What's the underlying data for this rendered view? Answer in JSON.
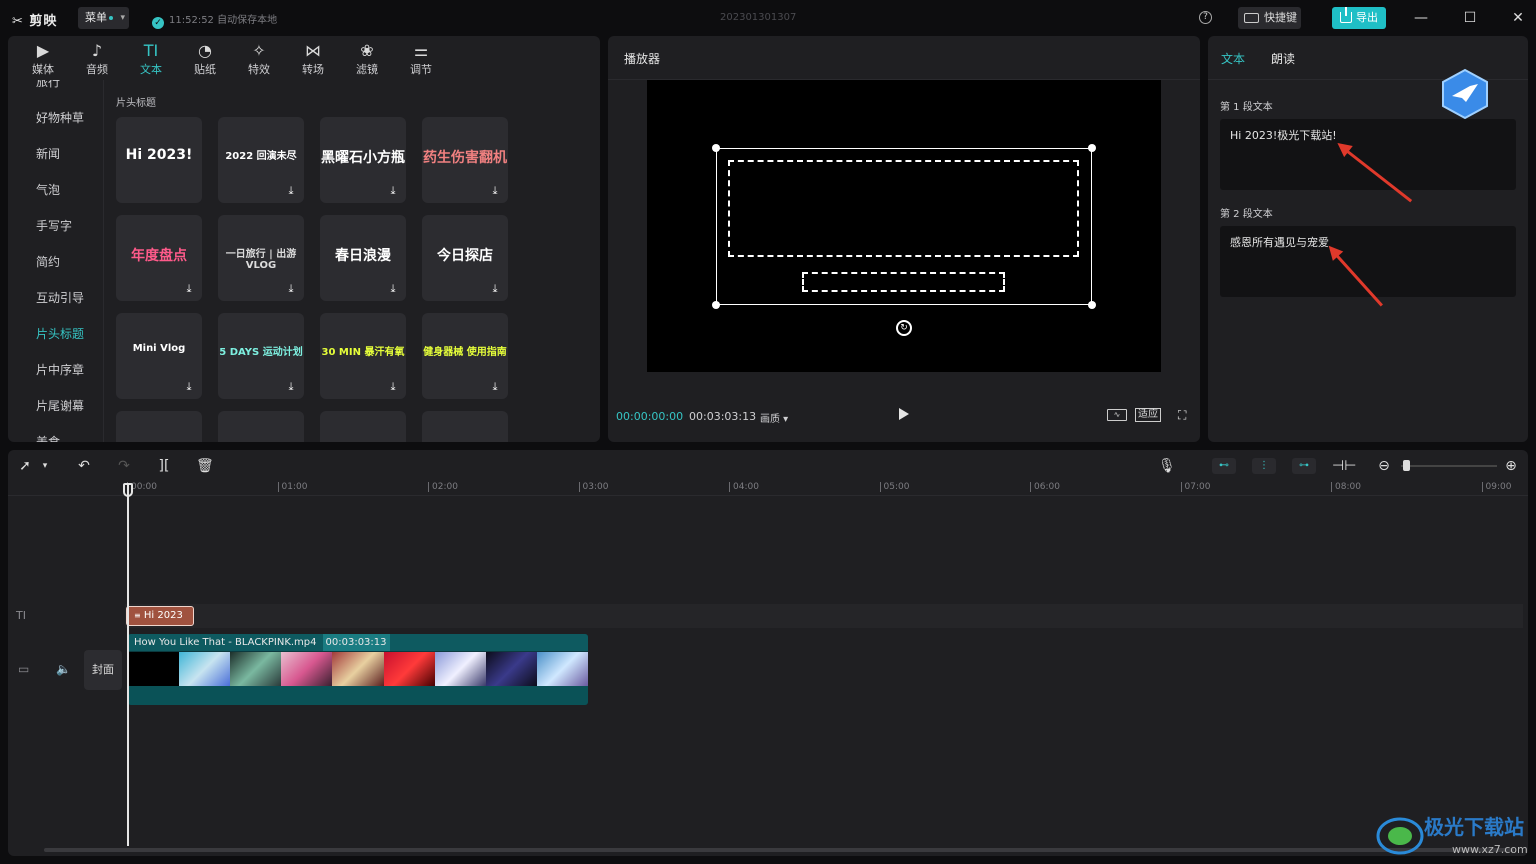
{
  "app": {
    "logo": "剪映",
    "menu_label": "菜单",
    "save_status": "11:52:52 自动保存本地",
    "project_name": "202301301307",
    "help_glyph": "?",
    "shortcut_label": "快捷键",
    "export_label": "导出"
  },
  "media_panel": {
    "tabs": [
      {
        "label": "媒体",
        "icon": "media-icon"
      },
      {
        "label": "音频",
        "icon": "audio-icon"
      },
      {
        "label": "文本",
        "icon": "text-icon",
        "active": true
      },
      {
        "label": "贴纸",
        "icon": "sticker-icon"
      },
      {
        "label": "特效",
        "icon": "effects-icon"
      },
      {
        "label": "转场",
        "icon": "transition-icon"
      },
      {
        "label": "滤镜",
        "icon": "filter-icon"
      },
      {
        "label": "调节",
        "icon": "adjust-icon"
      }
    ],
    "categories": [
      "旅行",
      "好物种草",
      "新闻",
      "气泡",
      "手写字",
      "简约",
      "互动引导",
      "片头标题",
      "片中序章",
      "片尾谢幕",
      "美食"
    ],
    "active_category": "片头标题",
    "section_title": "片头标题",
    "templates": [
      {
        "text": "Hi 2023!",
        "color": "#ffffff",
        "downloaded": true
      },
      {
        "text": "2022 回演未尽",
        "color": "#ffffff",
        "downloaded": false
      },
      {
        "text": "黑曜石小方瓶",
        "color": "#ffffff",
        "downloaded": false
      },
      {
        "text": "药生伤害翻机",
        "color": "#f08080",
        "downloaded": false
      },
      {
        "text": "年度盘点",
        "color": "#ff5a8a",
        "downloaded": false
      },
      {
        "text": "一日旅行 | 出游VLOG",
        "color": "#dddddd",
        "downloaded": false
      },
      {
        "text": "春日浪漫",
        "color": "#ffffff",
        "downloaded": false
      },
      {
        "text": "今日探店",
        "color": "#ffffff",
        "downloaded": false
      },
      {
        "text": "Mini Vlog",
        "color": "#ffffff",
        "downloaded": false
      },
      {
        "text": "5 DAYS 运动计划",
        "color": "#7ef0e0",
        "downloaded": false
      },
      {
        "text": "30 MIN 暴汗有氧",
        "color": "#e6ff3a",
        "downloaded": false
      },
      {
        "text": "健身器械 使用指南",
        "color": "#e6ff3a",
        "downloaded": false
      }
    ]
  },
  "player": {
    "title": "播放器",
    "current_time": "00:00:00:00",
    "total_time": "00:03:03:13",
    "quality_label": "画质",
    "fit_label": "适应"
  },
  "text_panel": {
    "tabs": [
      "文本",
      "朗读"
    ],
    "sections": [
      {
        "label": "第 1 段文本",
        "value": "Hi  2023!极光下载站!"
      },
      {
        "label": "第 2 段文本",
        "value": "感恩所有遇见与宠爱"
      }
    ]
  },
  "timeline": {
    "ruler": [
      "00:00",
      "01:00",
      "02:00",
      "03:00",
      "04:00",
      "05:00",
      "06:00",
      "07:00",
      "08:00",
      "09:00"
    ],
    "text_clip_label": "Hi  2023",
    "video_clip_name": "How You Like That - BLACKPINK.mp4",
    "video_clip_duration": "00:03:03:13",
    "cover_label": "封面",
    "text_track_glyph": "TI"
  },
  "colors": {
    "accent": "#36c4c4",
    "export": "#1fbfc6",
    "panel": "#1f1f22",
    "text_clip": "#a0523f",
    "video_clip": "#0e5a60"
  }
}
